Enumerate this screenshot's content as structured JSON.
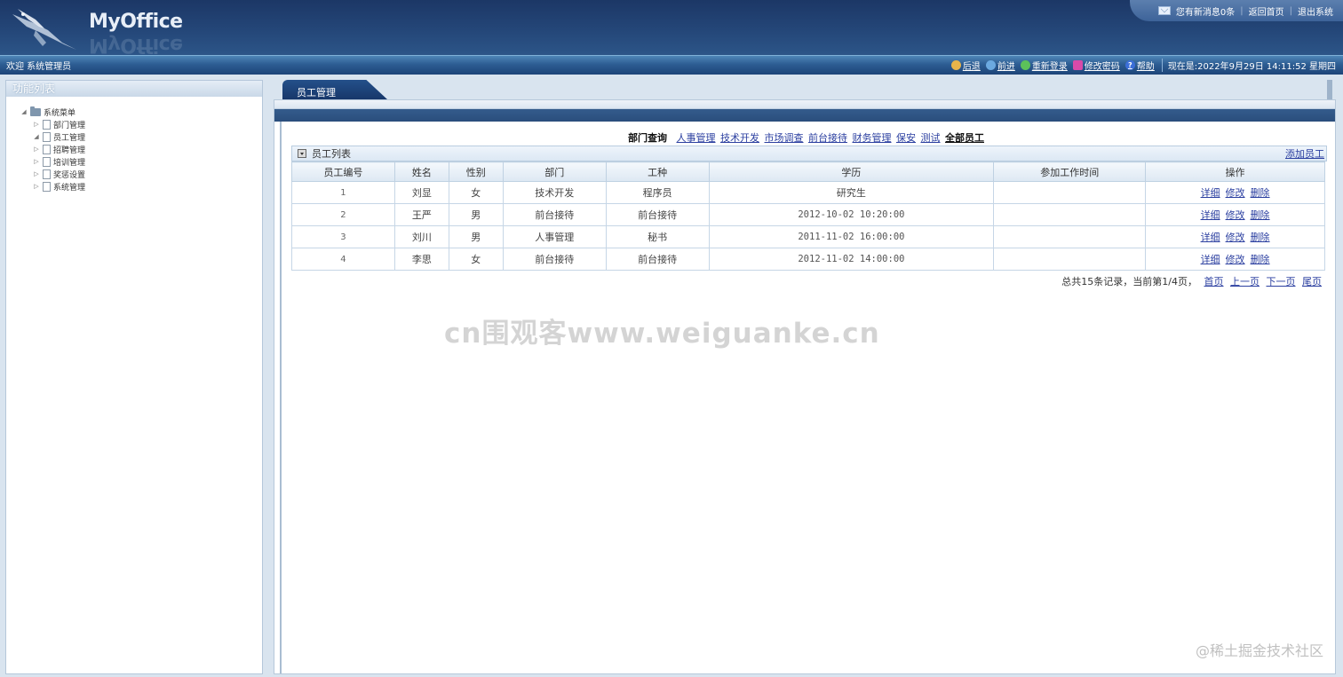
{
  "header": {
    "logo_text": "MyOffice",
    "messages_text": "您有新消息0条",
    "home_link": "返回首页",
    "logout_link": "退出系统"
  },
  "strip": {
    "welcome": "欢迎 系统管理员",
    "back": "后退",
    "forward": "前进",
    "relogin": "重新登录",
    "change_password": "修改密码",
    "help": "帮助",
    "current_time": "现在是:2022年9月29日 14:11:52 星期四"
  },
  "sidebar": {
    "title": "功能列表",
    "root": "系统菜单",
    "items": [
      "部门管理",
      "员工管理",
      "招聘管理",
      "培训管理",
      "奖惩设置",
      "系统管理"
    ]
  },
  "tab": {
    "label": "员工管理"
  },
  "query": {
    "label": "部门查询",
    "departments": [
      "人事管理",
      "技术开发",
      "市场调查",
      "前台接待",
      "财务管理",
      "保安",
      "测试"
    ],
    "all": "全部员工"
  },
  "list": {
    "title": "员工列表",
    "add_link": "添加员工",
    "columns": [
      "员工编号",
      "姓名",
      "性别",
      "部门",
      "工种",
      "学历",
      "参加工作时间",
      "操作"
    ],
    "actions": {
      "detail": "详细",
      "edit": "修改",
      "delete": "删除"
    },
    "rows": [
      {
        "id": "1",
        "name": "刘显",
        "gender": "女",
        "dept": "技术开发",
        "job": "程序员",
        "edu": "研究生",
        "start": ""
      },
      {
        "id": "2",
        "name": "王严",
        "gender": "男",
        "dept": "前台接待",
        "job": "前台接待",
        "edu": "2012-10-02 10:20:00",
        "start": ""
      },
      {
        "id": "3",
        "name": "刘川",
        "gender": "男",
        "dept": "人事管理",
        "job": "秘书",
        "edu": "2011-11-02 16:00:00",
        "start": ""
      },
      {
        "id": "4",
        "name": "李思",
        "gender": "女",
        "dept": "前台接待",
        "job": "前台接待",
        "edu": "2012-11-02 14:00:00",
        "start": ""
      }
    ]
  },
  "pager": {
    "summary": "总共15条记录，当前第1/4页，",
    "first": "首页",
    "prev": "上一页",
    "next": "下一页",
    "last": "尾页"
  },
  "watermarks": {
    "center": "cn围观客www.weiguanke.cn",
    "corner": "@稀土掘金技术社区"
  }
}
